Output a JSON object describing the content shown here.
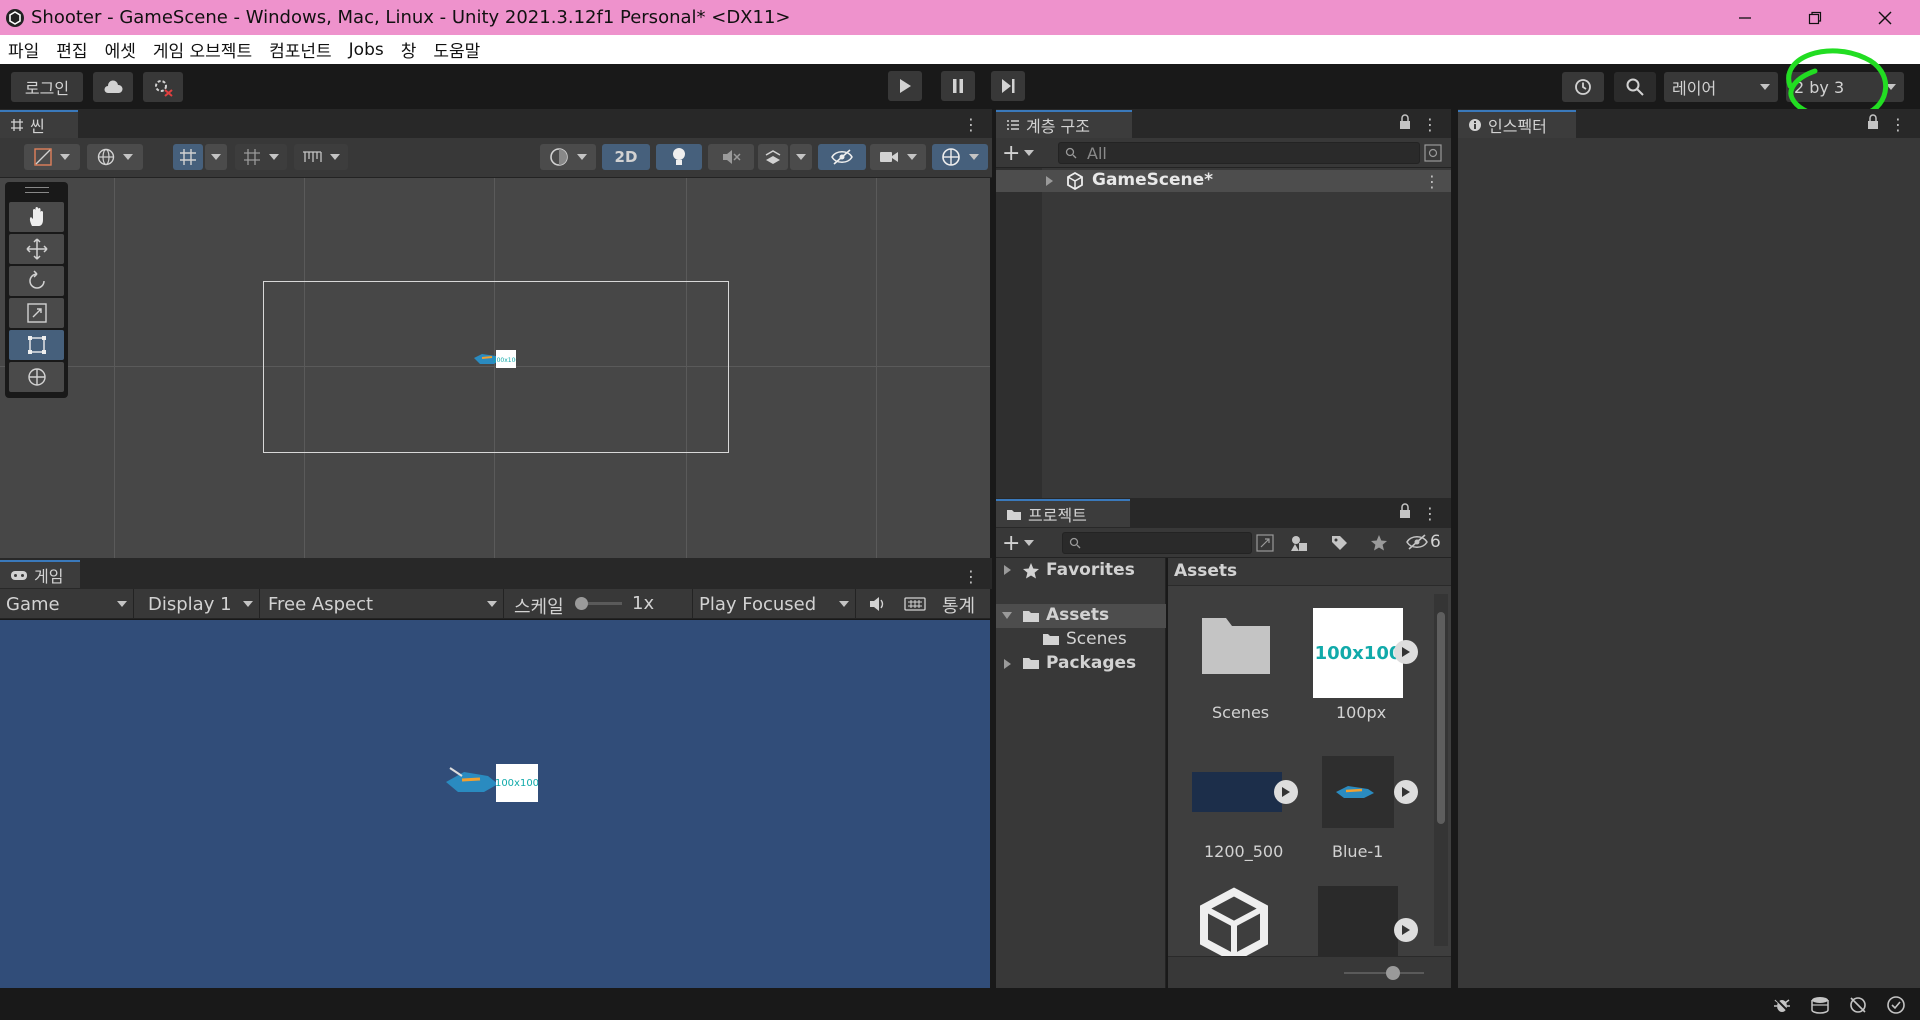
{
  "window": {
    "title": "Shooter - GameScene - Windows, Mac, Linux - Unity 2021.3.12f1 Personal* <DX11>"
  },
  "menu": [
    "파일",
    "편집",
    "에셋",
    "게임 오브젝트",
    "컴포넌트",
    "Jobs",
    "창",
    "도움말"
  ],
  "toolbar": {
    "login_label": "로그인",
    "layers_label": "레이어",
    "layout_label": "2 by 3"
  },
  "scene": {
    "tab_label": "씬",
    "mode_2d_label": "2D"
  },
  "game": {
    "tab_label": "게임",
    "view_select": "Game",
    "display_select": "Display 1",
    "aspect_select": "Free Aspect",
    "scale_label": "스케일",
    "scale_value": "1x",
    "play_mode_select": "Play Focused",
    "stats_label": "통계"
  },
  "hierarchy": {
    "tab_label": "계층 구조",
    "search_placeholder": "All",
    "scene_item": "GameScene*"
  },
  "inspector": {
    "tab_label": "인스펙터"
  },
  "project": {
    "tab_label": "프로젝트",
    "hidden_count": "6",
    "tree": {
      "favorites": "Favorites",
      "assets": "Assets",
      "scenes": "Scenes",
      "packages": "Packages"
    },
    "breadcrumb": "Assets",
    "assets": [
      {
        "name": "Scenes",
        "thumb_text": ""
      },
      {
        "name": "100px",
        "thumb_text": "100x100"
      },
      {
        "name": "1200_500",
        "thumb_text": ""
      },
      {
        "name": "Blue-1",
        "thumb_text": ""
      }
    ],
    "sprite_label": "100x100"
  },
  "colors": {
    "title_bar": "#ee92cc",
    "panel_bg": "#383838",
    "game_bg": "#314d79",
    "scene_bg": "#474747",
    "accent": "#46607c",
    "annotation": "#22dd22"
  }
}
